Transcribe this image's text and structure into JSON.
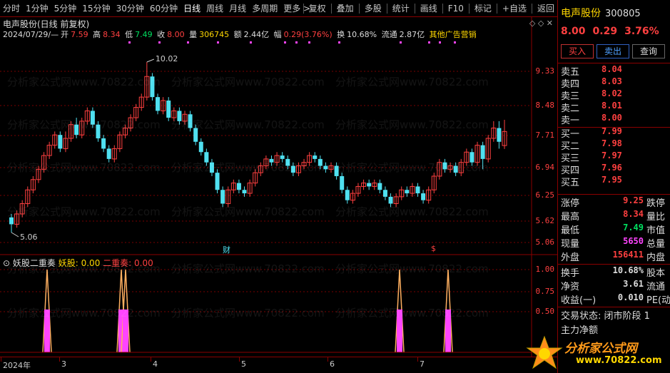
{
  "toolbar": {
    "items": [
      "分时",
      "1分钟",
      "5分钟",
      "15分钟",
      "30分钟",
      "60分钟",
      "日线",
      "周线",
      "月线",
      "多周期",
      "更多 >"
    ],
    "active": "日线",
    "right_items": [
      "复权",
      "叠加",
      "多股",
      "统计",
      "画线",
      "F10",
      "标记",
      "+自选",
      "返回"
    ]
  },
  "kline": {
    "title": "电声股份(日线 前复权)",
    "date": "2024/07/29/—",
    "open_label": "开",
    "open": "7.59",
    "high_label": "高",
    "high": "8.34",
    "low_label": "低",
    "low": "7.49",
    "close_label": "收",
    "close": "8.00",
    "vol_label": "量",
    "vol": "306745",
    "amount_label": "额",
    "amount": "2.44亿",
    "change_label": "幅",
    "change": "0.29(3.76%)",
    "turnover_label": "换",
    "turnover": "10.68%",
    "float_label": "流通",
    "float": "2.87亿",
    "extra": "其他广告营销",
    "price_ticks": [
      "9.33",
      "8.48",
      "7.71",
      "6.94",
      "6.25",
      "5.62",
      "5.06"
    ],
    "high_mark": "10.02",
    "low_mark": "5.06",
    "marker_fin": "财",
    "marker_s": "$"
  },
  "indicator": {
    "name": "妖股二重奏",
    "s1_label": "妖股:",
    "s1_value": "0.00",
    "s2_label": "二重奏:",
    "s2_value": "0.00",
    "ticks": [
      "1.00",
      "0.75",
      "0.50"
    ]
  },
  "date_axis": [
    "2024年",
    "3",
    "4",
    "5",
    "6",
    "7"
  ],
  "panel": {
    "name": "电声股份",
    "code": "300805",
    "price": "8.00",
    "change": "0.29",
    "change_pct": "3.76%",
    "buy_btn": "买入",
    "sell_btn": "卖出",
    "more_btn": "查询",
    "asks": [
      {
        "label": "卖五",
        "price": "8.04"
      },
      {
        "label": "卖四",
        "price": "8.03"
      },
      {
        "label": "卖三",
        "price": "8.02"
      },
      {
        "label": "卖二",
        "price": "8.01"
      },
      {
        "label": "卖一",
        "price": "8.00"
      }
    ],
    "bids": [
      {
        "label": "买一",
        "price": "7.99"
      },
      {
        "label": "买二",
        "price": "7.98"
      },
      {
        "label": "买三",
        "price": "7.97"
      },
      {
        "label": "买四",
        "price": "7.96"
      },
      {
        "label": "买五",
        "price": "7.95"
      }
    ],
    "stats": [
      {
        "label": "涨停",
        "value": "9.25",
        "color": "#ff4040",
        "label2": "跌停"
      },
      {
        "label": "最高",
        "value": "8.34",
        "color": "#ff4040",
        "label2": "量比"
      },
      {
        "label": "最低",
        "value": "7.49",
        "color": "#00e060",
        "label2": "市值"
      },
      {
        "label": "现量",
        "value": "5650",
        "color": "#ff44ff",
        "label2": "总量"
      },
      {
        "label": "外盘",
        "value": "156411",
        "color": "#ff4040",
        "label2": "内盘"
      }
    ],
    "stats2": [
      {
        "label": "换手",
        "value": "10.68%",
        "color": "#ddd",
        "label2": "股本"
      },
      {
        "label": "净资",
        "value": "3.61",
        "color": "#ddd",
        "label2": "流通"
      },
      {
        "label": "收益(一)",
        "value": "0.010",
        "color": "#ddd",
        "label2": "PE(动"
      }
    ],
    "trade_status": "交易状态: 闭市阶段 1",
    "main_flow": "主力净额"
  },
  "logo": {
    "text": "分析家公式网",
    "url": "www.70822.com"
  },
  "watermark": "分析家公式网www.70822.com",
  "colors": {
    "up": "#ff4040",
    "down": "#4fe0f0",
    "grid": "#8b0000",
    "indicator1": "#ffb060",
    "indicator2": "#ff44ff"
  }
}
